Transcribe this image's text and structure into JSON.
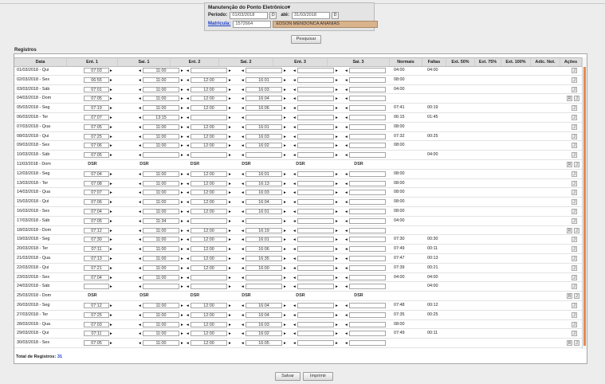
{
  "header": {
    "title": "Manutenção do Ponto Eletrônico",
    "periodo_label": "Período:",
    "periodo_start": "01/03/2018",
    "ate_label": "até:",
    "periodo_end": "31/03/2018",
    "matricula_label": "Matrícula:",
    "matricula_value": "1572664",
    "employee_name": "EDSON MENDONCA ANANIAS",
    "search_label": "Pesquisar"
  },
  "section_title": "Registros",
  "columns": [
    "Data",
    "Ent. 1",
    "Sai. 1",
    "Ent. 2",
    "Sai. 2",
    "Ent. 3",
    "Sai. 3",
    "Normais",
    "Faltas",
    "Ext. 50%",
    "Ext. 75%",
    "Ext. 100%",
    "Adic. Not.",
    "Ações"
  ],
  "rows": [
    {
      "date": "01/03/2018 - Qui",
      "e1": "07:03",
      "s1": "11:00",
      "e2": "",
      "s2": "",
      "e3": "",
      "s3": "",
      "normais": "04:00",
      "faltas": "04:00",
      "dsr": false,
      "r": false
    },
    {
      "date": "02/03/2018 - Sex",
      "e1": "06:55",
      "s1": "11:00",
      "e2": "12:00",
      "s2": "16:01",
      "e3": "",
      "s3": "",
      "normais": "08:00",
      "faltas": "",
      "dsr": false,
      "r": false
    },
    {
      "date": "03/03/2018 - Sáb",
      "e1": "07:01",
      "s1": "11:00",
      "e2": "12:00",
      "s2": "16:03",
      "e3": "",
      "s3": "",
      "normais": "04:00",
      "faltas": "",
      "dsr": false,
      "r": false
    },
    {
      "date": "04/03/2018 - Dom",
      "e1": "07:05",
      "s1": "11:00",
      "e2": "12:00",
      "s2": "16:04",
      "e3": "",
      "s3": "",
      "normais": "",
      "faltas": "",
      "dsr": false,
      "r": true
    },
    {
      "date": "05/03/2018 - Seg",
      "e1": "07:19",
      "s1": "11:00",
      "e2": "12:00",
      "s2": "16:06",
      "e3": "",
      "s3": "",
      "normais": "07:41",
      "faltas": "00:19",
      "dsr": false,
      "r": false
    },
    {
      "date": "06/03/2018 - Ter",
      "e1": "07:07",
      "s1": "13:15",
      "e2": "",
      "s2": "",
      "e3": "",
      "s3": "",
      "normais": "06:15",
      "faltas": "01:45",
      "dsr": false,
      "r": false
    },
    {
      "date": "07/03/2018 - Qua",
      "e1": "07:05",
      "s1": "11:00",
      "e2": "12:00",
      "s2": "16:01",
      "e3": "",
      "s3": "",
      "normais": "08:00",
      "faltas": "",
      "dsr": false,
      "r": false
    },
    {
      "date": "08/03/2018 - Qui",
      "e1": "07:25",
      "s1": "11:00",
      "e2": "12:00",
      "s2": "16:03",
      "e3": "",
      "s3": "",
      "normais": "07:32",
      "faltas": "00:25",
      "dsr": false,
      "r": false
    },
    {
      "date": "09/03/2018 - Sex",
      "e1": "07:06",
      "s1": "11:00",
      "e2": "12:00",
      "s2": "16:02",
      "e3": "",
      "s3": "",
      "normais": "08:00",
      "faltas": "",
      "dsr": false,
      "r": false
    },
    {
      "date": "10/03/2018 - Sáb",
      "e1": "07:05",
      "s1": "",
      "e2": "",
      "s2": "",
      "e3": "",
      "s3": "",
      "normais": "",
      "faltas": "04:00",
      "dsr": false,
      "r": false
    },
    {
      "date": "11/03/2018 - Dom",
      "dsr": true,
      "r": true
    },
    {
      "date": "12/03/2018 - Seg",
      "e1": "07:04",
      "s1": "11:00",
      "e2": "12:00",
      "s2": "16:01",
      "e3": "",
      "s3": "",
      "normais": "08:00",
      "faltas": "",
      "dsr": false,
      "r": false
    },
    {
      "date": "13/03/2018 - Ter",
      "e1": "07:08",
      "s1": "11:00",
      "e2": "12:00",
      "s2": "16:13",
      "e3": "",
      "s3": "",
      "normais": "08:00",
      "faltas": "",
      "dsr": false,
      "r": false
    },
    {
      "date": "14/03/2018 - Qua",
      "e1": "07:07",
      "s1": "11:00",
      "e2": "12:00",
      "s2": "16:03",
      "e3": "",
      "s3": "",
      "normais": "08:00",
      "faltas": "",
      "dsr": false,
      "r": false
    },
    {
      "date": "15/03/2018 - Qui",
      "e1": "07:06",
      "s1": "11:00",
      "e2": "12:00",
      "s2": "16:04",
      "e3": "",
      "s3": "",
      "normais": "08:00",
      "faltas": "",
      "dsr": false,
      "r": false
    },
    {
      "date": "16/03/2018 - Sex",
      "e1": "07:04",
      "s1": "11:00",
      "e2": "12:00",
      "s2": "16:01",
      "e3": "",
      "s3": "",
      "normais": "08:00",
      "faltas": "",
      "dsr": false,
      "r": false
    },
    {
      "date": "17/03/2018 - Sáb",
      "e1": "07:05",
      "s1": "11:34",
      "e2": "",
      "s2": "",
      "e3": "",
      "s3": "",
      "normais": "04:00",
      "faltas": "",
      "dsr": false,
      "r": false
    },
    {
      "date": "18/03/2018 - Dom",
      "e1": "07:12",
      "s1": "11:00",
      "e2": "12:00",
      "s2": "16:19",
      "e3": "",
      "s3": "",
      "normais": "",
      "faltas": "",
      "dsr": false,
      "r": true
    },
    {
      "date": "19/03/2018 - Seg",
      "e1": "07:30",
      "s1": "11:00",
      "e2": "12:00",
      "s2": "16:01",
      "e3": "",
      "s3": "",
      "normais": "07:30",
      "faltas": "00:30",
      "dsr": false,
      "r": false
    },
    {
      "date": "20/03/2018 - Ter",
      "e1": "07:11",
      "s1": "11:00",
      "e2": "12:00",
      "s2": "16:06",
      "e3": "",
      "s3": "",
      "normais": "07:49",
      "faltas": "00:11",
      "dsr": false,
      "r": false
    },
    {
      "date": "21/03/2018 - Qua",
      "e1": "07:13",
      "s1": "11:00",
      "e2": "12:00",
      "s2": "16:35",
      "e3": "",
      "s3": "",
      "normais": "07:47",
      "faltas": "00:13",
      "dsr": false,
      "r": false
    },
    {
      "date": "22/03/2018 - Qui",
      "e1": "07:21",
      "s1": "11:00",
      "e2": "12:00",
      "s2": "16:00",
      "e3": "",
      "s3": "",
      "normais": "07:39",
      "faltas": "00:21",
      "dsr": false,
      "r": false
    },
    {
      "date": "23/03/2018 - Sex",
      "e1": "07:04",
      "s1": "11:00",
      "e2": "",
      "s2": "",
      "e3": "",
      "s3": "",
      "normais": "04:00",
      "faltas": "04:00",
      "dsr": false,
      "r": false
    },
    {
      "date": "24/03/2018 - Sáb",
      "e1": "",
      "s1": "",
      "e2": "",
      "s2": "",
      "e3": "",
      "s3": "",
      "normais": "",
      "faltas": "04:00",
      "dsr": false,
      "r": false
    },
    {
      "date": "25/03/2018 - Dom",
      "dsr": true,
      "r": true
    },
    {
      "date": "26/03/2018 - Seg",
      "e1": "07:12",
      "s1": "11:00",
      "e2": "12:00",
      "s2": "16:04",
      "e3": "",
      "s3": "",
      "normais": "07:48",
      "faltas": "00:12",
      "dsr": false,
      "r": false
    },
    {
      "date": "27/03/2018 - Ter",
      "e1": "07:25",
      "s1": "11:00",
      "e2": "12:00",
      "s2": "16:04",
      "e3": "",
      "s3": "",
      "normais": "07:35",
      "faltas": "00:25",
      "dsr": false,
      "r": false
    },
    {
      "date": "28/03/2018 - Qua",
      "e1": "07:03",
      "s1": "11:00",
      "e2": "12:00",
      "s2": "16:03",
      "e3": "",
      "s3": "",
      "normais": "08:00",
      "faltas": "",
      "dsr": false,
      "r": false
    },
    {
      "date": "29/03/2018 - Qui",
      "e1": "07:11",
      "s1": "11:00",
      "e2": "12:00",
      "s2": "16:02",
      "e3": "",
      "s3": "",
      "normais": "07:49",
      "faltas": "00:11",
      "dsr": false,
      "r": false
    },
    {
      "date": "30/03/2018 - Sex",
      "e1": "07:05",
      "s1": "11:00",
      "e2": "12:00",
      "s2": "16:05",
      "e3": "",
      "s3": "",
      "normais": "",
      "faltas": "",
      "dsr": false,
      "r": true
    }
  ],
  "dsr_label": "DSR",
  "action_r": "R",
  "action_j": "J",
  "total_label": "Total de Registros:",
  "total_value": "31",
  "save_label": "Salvar",
  "print_label": "Imprimir"
}
